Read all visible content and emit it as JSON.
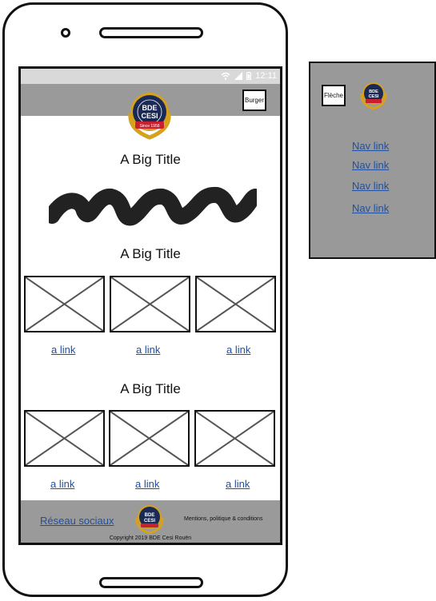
{
  "statusbar": {
    "time": "12:11",
    "icons": [
      "wifi-icon",
      "signal-icon",
      "battery-icon"
    ]
  },
  "header": {
    "burger_label": "Burger",
    "logo_text_top": "BDE",
    "logo_text_bottom": "CESI",
    "logo_band": "Since 1958"
  },
  "main": {
    "titles": [
      "A Big Title",
      "A Big Title",
      "A Big Title"
    ],
    "row1_links": [
      "a link",
      "a link",
      "a link"
    ],
    "row2_links": [
      "a link",
      "a link",
      "a link"
    ]
  },
  "footer": {
    "social": "Réseau sociaux",
    "legal": "Mentions, politique & conditions",
    "copyright": "Copyright 2019 BDE Cesi Rouën"
  },
  "side_menu": {
    "back_label": "Flèche",
    "nav_links": [
      "Nav link",
      "Nav link",
      "Nav link",
      "Nav link"
    ]
  },
  "colors": {
    "header_bg": "#9a9a9a",
    "link": "#1f4f9e",
    "logo_navy": "#1b2a55",
    "logo_gold": "#d6a21e",
    "logo_red": "#c8202e"
  }
}
